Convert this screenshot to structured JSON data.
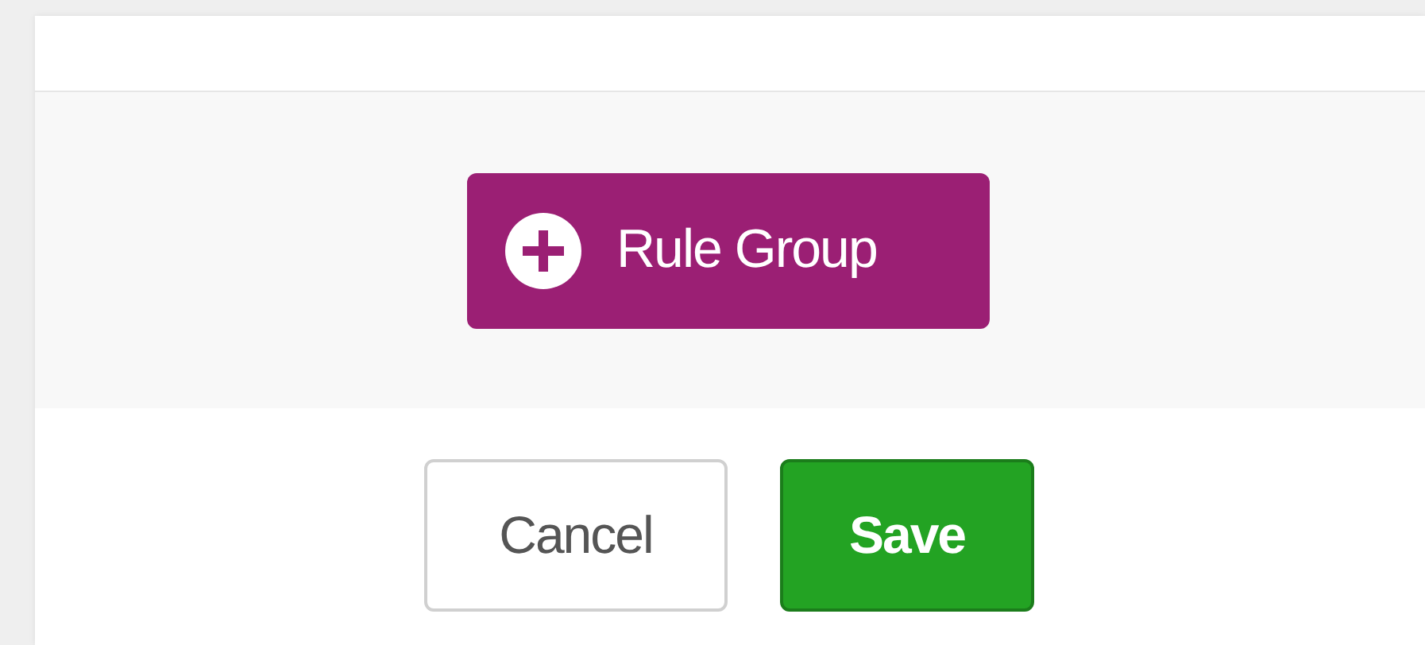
{
  "add_button": {
    "label": "Rule Group"
  },
  "buttons": [
    {
      "label": "Cancel",
      "kind": "secondary"
    },
    {
      "label": "Save",
      "kind": "primary"
    }
  ]
}
